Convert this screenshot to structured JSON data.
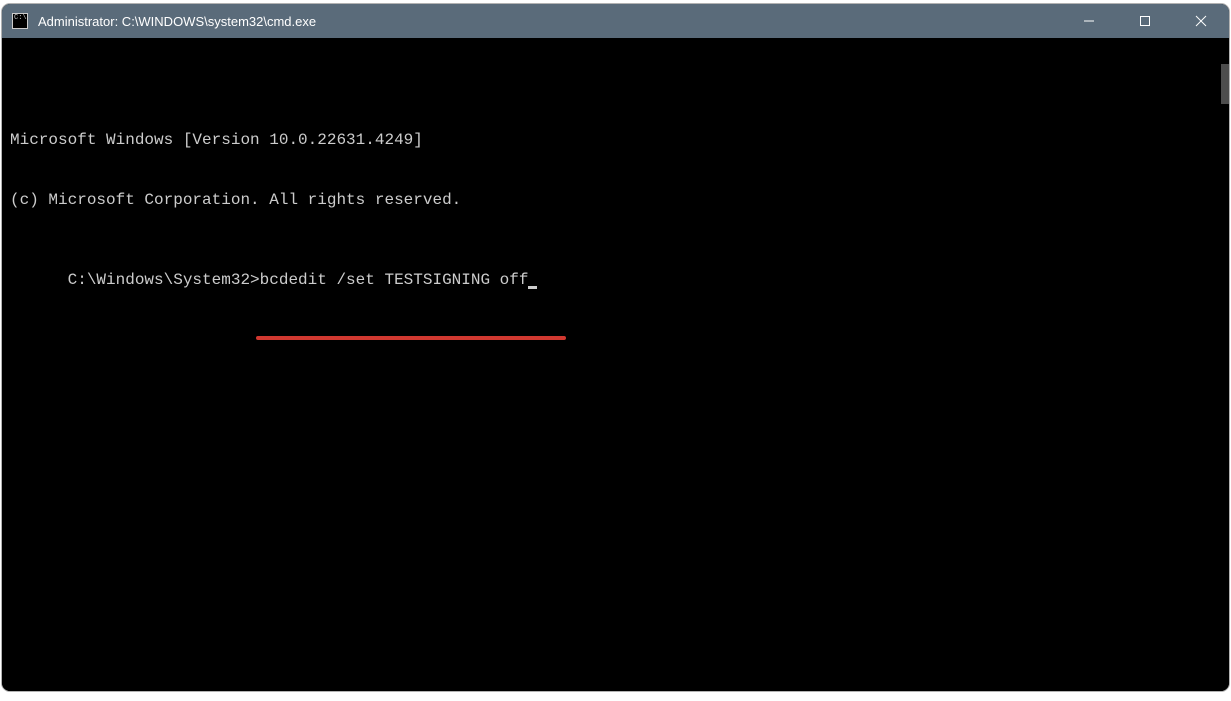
{
  "titlebar": {
    "title": "Administrator: C:\\WINDOWS\\system32\\cmd.exe"
  },
  "terminal": {
    "line1": "Microsoft Windows [Version 10.0.22631.4249]",
    "line2": "(c) Microsoft Corporation. All rights reserved.",
    "blank": "",
    "prompt": "C:\\Windows\\System32>",
    "command": "bcdedit /set TESTSIGNING off"
  },
  "annotation": {
    "underline_color": "#d13830"
  }
}
